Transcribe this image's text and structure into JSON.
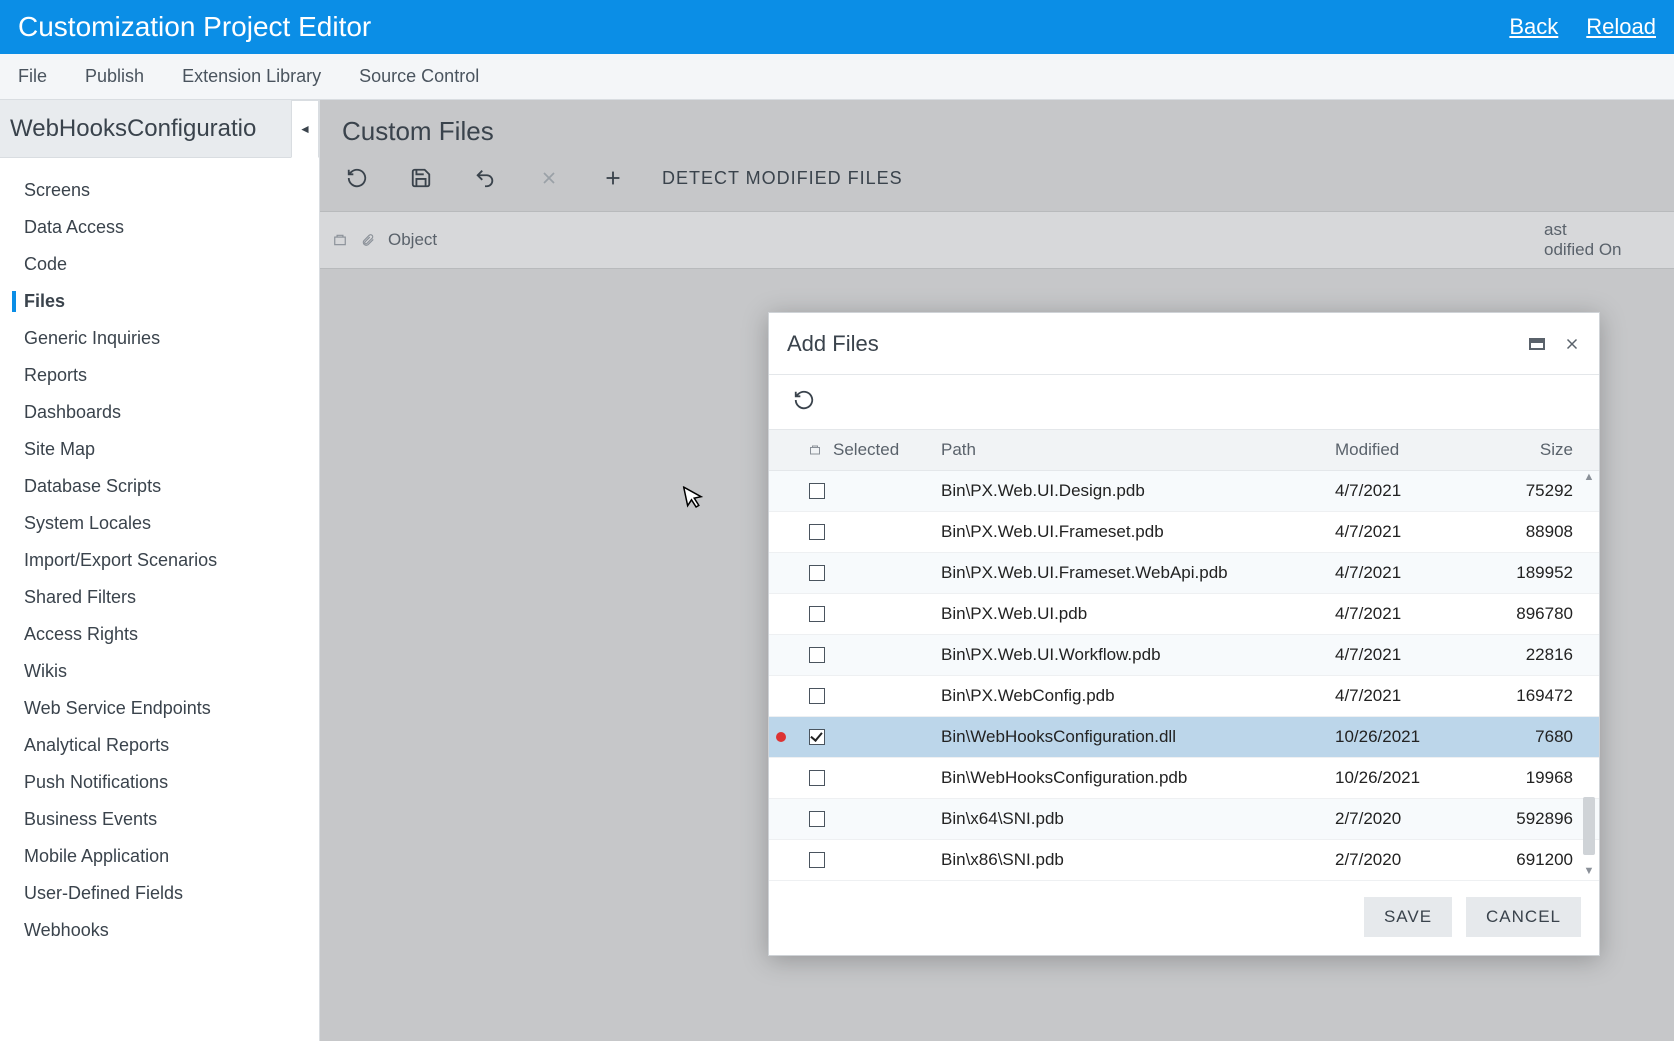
{
  "banner": {
    "title": "Customization Project Editor",
    "back": "Back",
    "reload": "Reload"
  },
  "menu": {
    "file": "File",
    "publish": "Publish",
    "extension_library": "Extension Library",
    "source_control": "Source Control"
  },
  "sidebar": {
    "project_name": "WebHooksConfiguratio",
    "items": [
      {
        "label": "Screens"
      },
      {
        "label": "Data Access"
      },
      {
        "label": "Code"
      },
      {
        "label": "Files"
      },
      {
        "label": "Generic Inquiries"
      },
      {
        "label": "Reports"
      },
      {
        "label": "Dashboards"
      },
      {
        "label": "Site Map"
      },
      {
        "label": "Database Scripts"
      },
      {
        "label": "System Locales"
      },
      {
        "label": "Import/Export Scenarios"
      },
      {
        "label": "Shared Filters"
      },
      {
        "label": "Access Rights"
      },
      {
        "label": "Wikis"
      },
      {
        "label": "Web Service Endpoints"
      },
      {
        "label": "Analytical Reports"
      },
      {
        "label": "Push Notifications"
      },
      {
        "label": "Business Events"
      },
      {
        "label": "Mobile Application"
      },
      {
        "label": "User-Defined Fields"
      },
      {
        "label": "Webhooks"
      }
    ],
    "active_index": 3
  },
  "content": {
    "heading": "Custom Files",
    "toolbar": {
      "detect_modified": "DETECT MODIFIED FILES"
    },
    "bg_table": {
      "object_col": "Object",
      "last_col_line1": "ast",
      "last_col_line2": "odified On"
    }
  },
  "dialog": {
    "title": "Add Files",
    "columns": {
      "selected": "Selected",
      "path": "Path",
      "modified": "Modified",
      "size": "Size"
    },
    "rows": [
      {
        "selected": false,
        "marker": false,
        "path": "Bin\\PX.Web.UI.Design.pdb",
        "modified": "4/7/2021",
        "size": "75292"
      },
      {
        "selected": false,
        "marker": false,
        "path": "Bin\\PX.Web.UI.Frameset.pdb",
        "modified": "4/7/2021",
        "size": "88908"
      },
      {
        "selected": false,
        "marker": false,
        "path": "Bin\\PX.Web.UI.Frameset.WebApi.pdb",
        "modified": "4/7/2021",
        "size": "189952"
      },
      {
        "selected": false,
        "marker": false,
        "path": "Bin\\PX.Web.UI.pdb",
        "modified": "4/7/2021",
        "size": "896780"
      },
      {
        "selected": false,
        "marker": false,
        "path": "Bin\\PX.Web.UI.Workflow.pdb",
        "modified": "4/7/2021",
        "size": "22816"
      },
      {
        "selected": false,
        "marker": false,
        "path": "Bin\\PX.WebConfig.pdb",
        "modified": "4/7/2021",
        "size": "169472"
      },
      {
        "selected": true,
        "marker": true,
        "path": "Bin\\WebHooksConfiguration.dll",
        "modified": "10/26/2021",
        "size": "7680"
      },
      {
        "selected": false,
        "marker": false,
        "path": "Bin\\WebHooksConfiguration.pdb",
        "modified": "10/26/2021",
        "size": "19968"
      },
      {
        "selected": false,
        "marker": false,
        "path": "Bin\\x64\\SNI.pdb",
        "modified": "2/7/2020",
        "size": "592896"
      },
      {
        "selected": false,
        "marker": false,
        "path": "Bin\\x86\\SNI.pdb",
        "modified": "2/7/2020",
        "size": "691200"
      }
    ],
    "buttons": {
      "save": "SAVE",
      "cancel": "CANCEL"
    }
  }
}
